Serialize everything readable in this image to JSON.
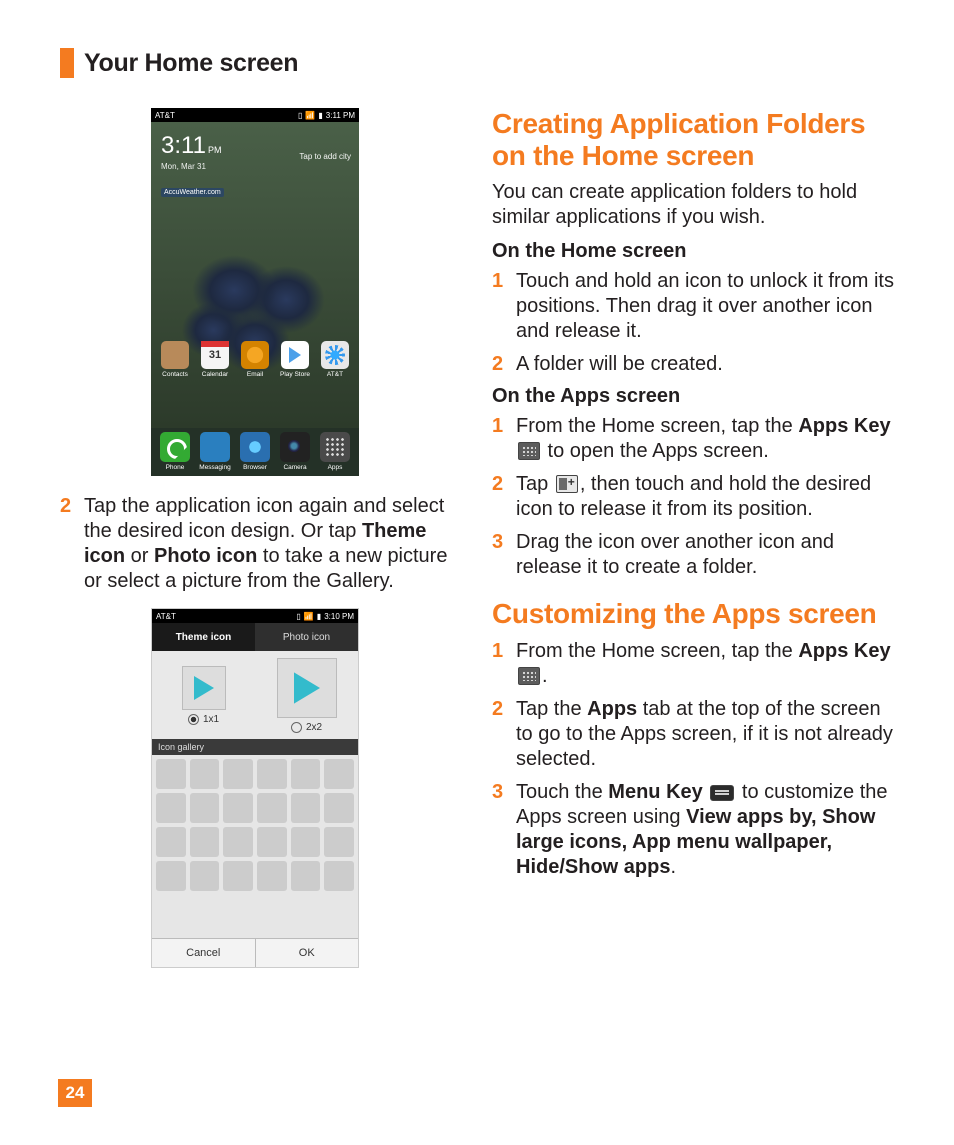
{
  "header": {
    "title": "Your Home screen"
  },
  "pageNumber": "24",
  "phone1": {
    "carrier": "AT&T",
    "statusTime": "3:11 PM",
    "clockTime": "3:11",
    "clockAmPm": "PM",
    "clockDate": "Mon, Mar 31",
    "weatherHint": "Tap to add city",
    "accu": "AccuWeather.com",
    "row1": [
      {
        "label": "Contacts",
        "cls": "contacts"
      },
      {
        "label": "Calendar",
        "cls": "cal"
      },
      {
        "label": "Email",
        "cls": "email"
      },
      {
        "label": "Play Store",
        "cls": "play"
      },
      {
        "label": "AT&T",
        "cls": "att"
      }
    ],
    "dock": [
      {
        "label": "Phone",
        "cls": "phone"
      },
      {
        "label": "Messaging",
        "cls": "msg"
      },
      {
        "label": "Browser",
        "cls": "browser"
      },
      {
        "label": "Camera",
        "cls": "camera"
      },
      {
        "label": "Apps",
        "cls": "apps"
      }
    ]
  },
  "leftStep": {
    "num": "2",
    "text_a": "Tap the application icon again and select the desired icon design. Or tap ",
    "bold_a": "Theme icon",
    "text_b": " or ",
    "bold_b": "Photo icon",
    "text_c": " to take a new picture or select a picture from the Gallery."
  },
  "phone2": {
    "carrier": "AT&T",
    "statusTime": "3:10 PM",
    "tab1": "Theme icon",
    "tab2": "Photo icon",
    "size1": "1x1",
    "size2": "2x2",
    "galleryLabel": "Icon gallery",
    "cancel": "Cancel",
    "ok": "OK"
  },
  "right": {
    "h1": "Creating Application Folders on the Home screen",
    "p1": "You can create application folders to hold similar applications if you wish.",
    "sub1": "On the Home screen",
    "home_steps": [
      "Touch and hold an icon to unlock it from its positions. Then drag it over another icon and release it.",
      "A folder will be created."
    ],
    "sub2": "On the Apps screen",
    "apps_step1_a": "From the Home screen, tap the ",
    "apps_step1_bold": "Apps Key",
    "apps_step1_b": " to open the Apps screen.",
    "apps_step2_a": "Tap ",
    "apps_step2_b": ", then touch and hold the desired icon to release it from its position.",
    "apps_step3": "Drag the icon over another icon and release it to create a folder.",
    "h2": "Customizing the Apps screen",
    "cust_step1_a": "From the Home screen, tap the ",
    "cust_step1_bold": "Apps Key",
    "cust_step1_b": ".",
    "cust_step2_a": "Tap the ",
    "cust_step2_bold": "Apps",
    "cust_step2_b": " tab at the top of the screen to go to the Apps screen, if it is not already selected.",
    "cust_step3_a": "Touch the ",
    "cust_step3_bold1": "Menu Key",
    "cust_step3_b": " to customize the Apps screen using ",
    "cust_step3_bold2": "View apps by, Show large icons, App menu wallpaper, Hide/Show apps",
    "cust_step3_c": "."
  }
}
